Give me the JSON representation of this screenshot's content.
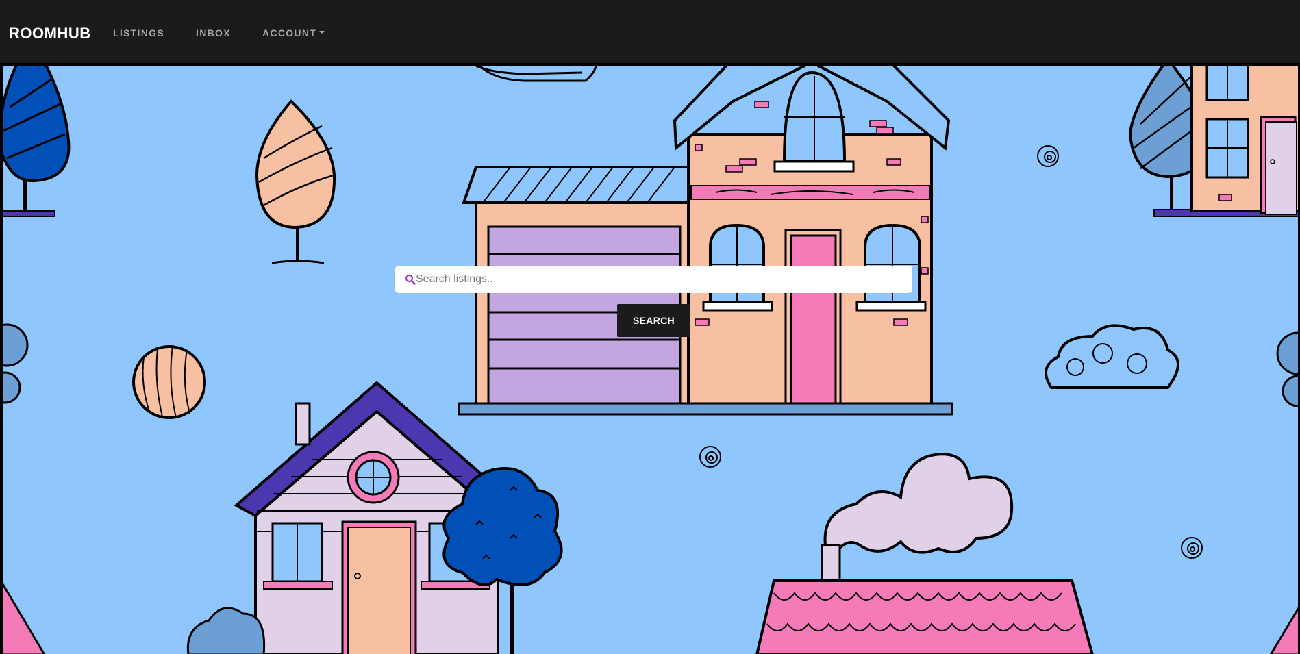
{
  "navbar": {
    "brand": "ROOMHUB",
    "links": [
      {
        "label": "LISTINGS"
      },
      {
        "label": "INBOX"
      },
      {
        "label": "ACCOUNT"
      }
    ]
  },
  "search": {
    "placeholder": "Search listings...",
    "value": "",
    "button_label": "SEARCH"
  },
  "colors": {
    "navbar_bg": "#1b1b1b",
    "hero_bg": "#8fc6fd",
    "search_icon": "#a344c8"
  },
  "icons": {
    "search": "search-icon",
    "account_dropdown": "caret-down-icon"
  }
}
